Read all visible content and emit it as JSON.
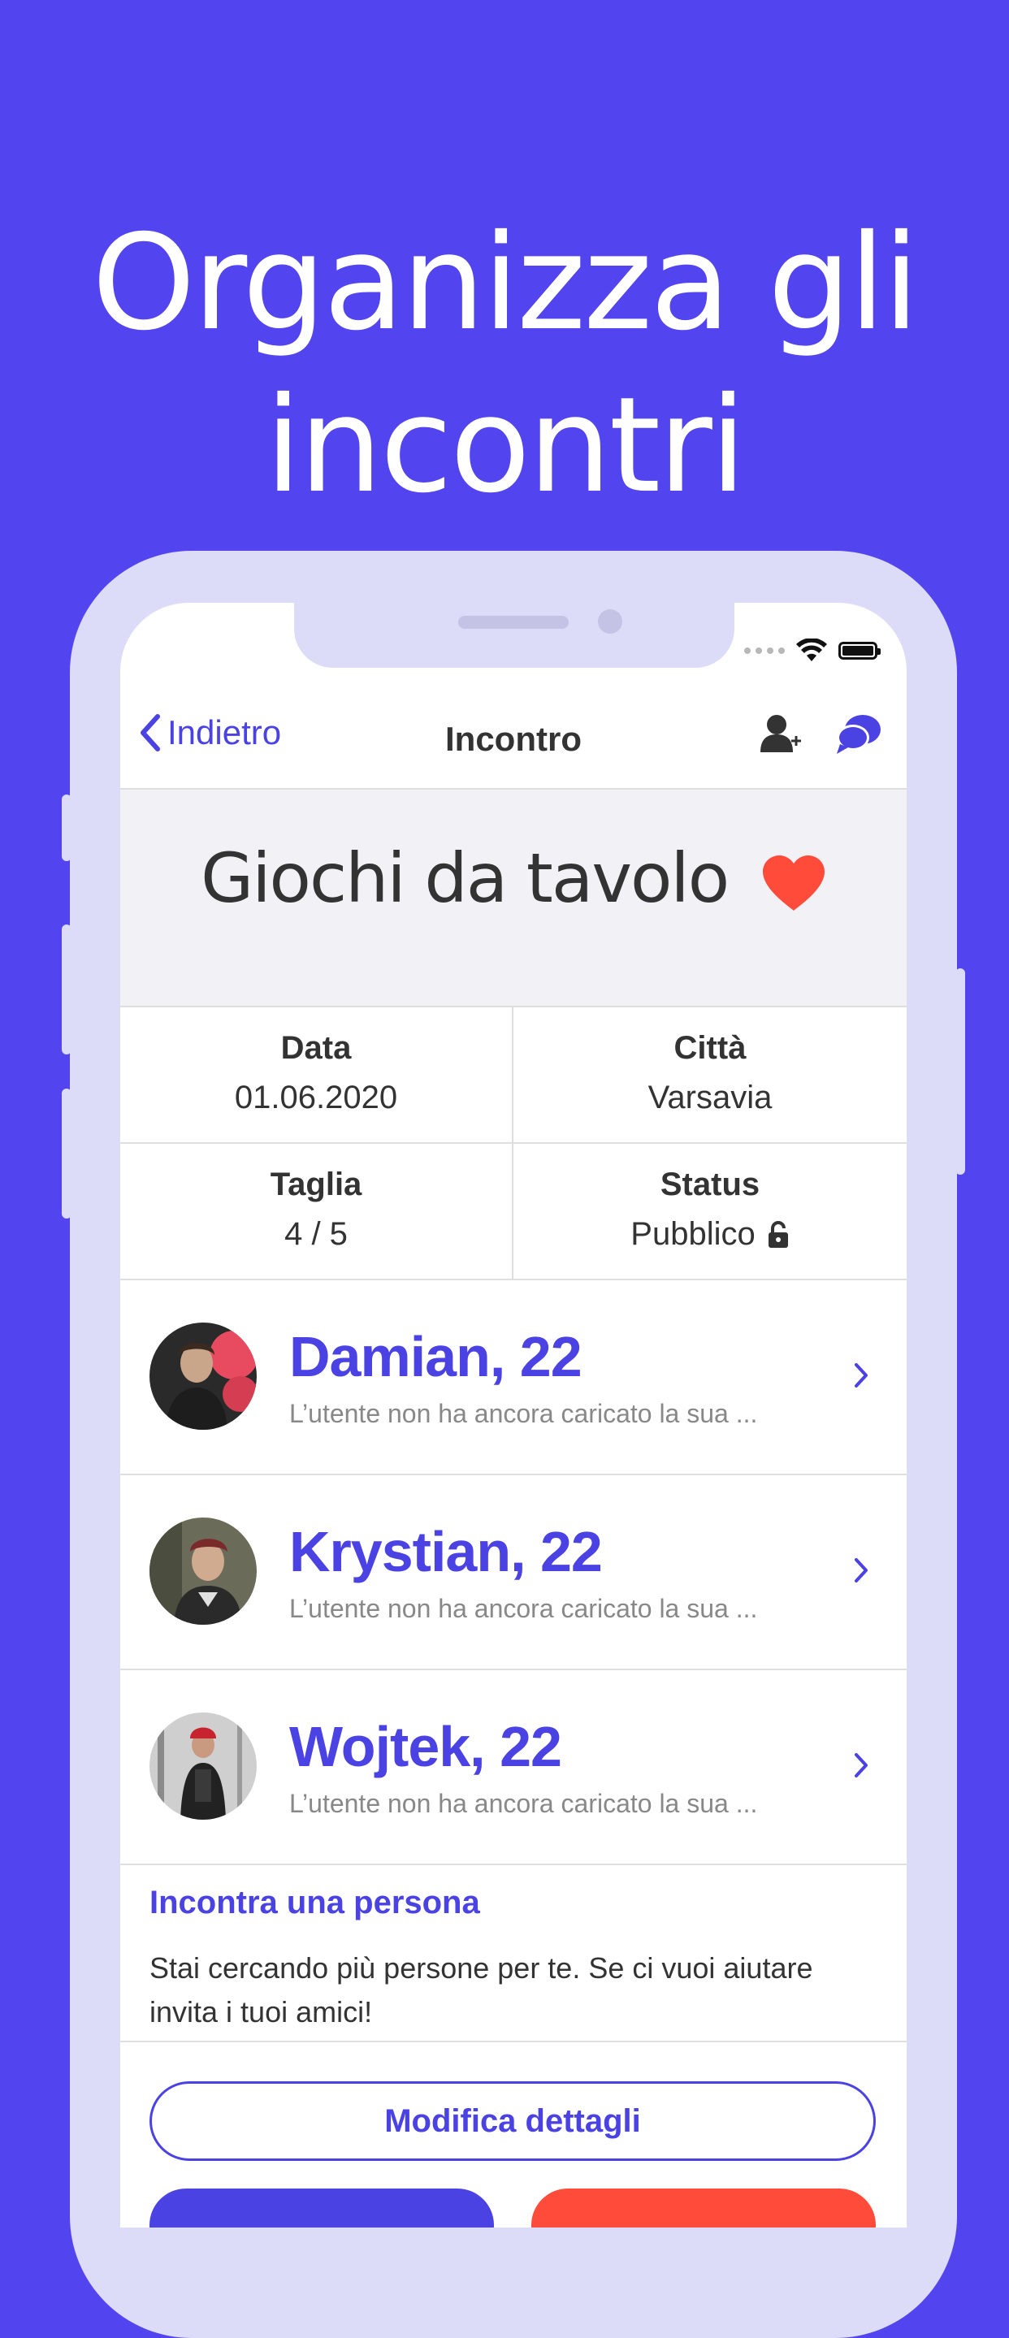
{
  "headline": {
    "line1": "Organizza gli",
    "line2": "incontri"
  },
  "nav": {
    "back_label": "Indietro",
    "title": "Incontro",
    "actions": [
      "add-user-icon",
      "chat-icon"
    ]
  },
  "event": {
    "title": "Giochi da tavolo",
    "title_icon": "heart-icon"
  },
  "details": {
    "date_label": "Data",
    "date_value": "01.06.2020",
    "city_label": "Città",
    "city_value": "Varsavia",
    "size_label": "Taglia",
    "size_value": "4 / 5",
    "status_label": "Status",
    "status_value": "Pubblico",
    "status_icon": "lock-open-icon"
  },
  "people": [
    {
      "name": "Damian, 22",
      "subtitle": "L’utente non ha ancora caricato la sua ..."
    },
    {
      "name": "Krystian, 22",
      "subtitle": "L’utente non ha ancora caricato la sua ..."
    },
    {
      "name": "Wojtek, 22",
      "subtitle": "L’utente non ha ancora caricato la sua ..."
    }
  ],
  "meet": {
    "title": "Incontra una persona",
    "text": "Stai cercando più persone per te. Se ci vuoi aiutare invita i tuoi amici!"
  },
  "buttons": {
    "edit_label": "Modifica dettagli"
  },
  "colors": {
    "background": "#5245f0",
    "accent": "#4b42e4",
    "heart": "#ff4b3a",
    "phone_frame": "#dcdbf8"
  }
}
